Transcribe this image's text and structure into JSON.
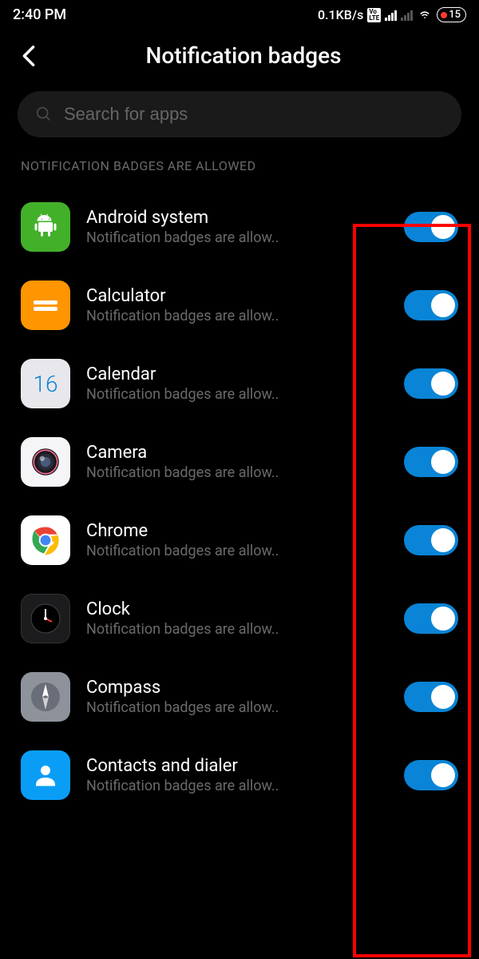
{
  "statusBar": {
    "time": "2:40 PM",
    "netSpeed": "0.1KB/s",
    "battery": "15"
  },
  "header": {
    "title": "Notification badges"
  },
  "search": {
    "placeholder": "Search for apps"
  },
  "section": {
    "label": "NOTIFICATION BADGES ARE ALLOWED"
  },
  "apps": [
    {
      "name": "Android system",
      "desc": "Notification badges are allow..",
      "icon": "android",
      "enabled": true
    },
    {
      "name": "Calculator",
      "desc": "Notification badges are allow..",
      "icon": "calculator",
      "enabled": true
    },
    {
      "name": "Calendar",
      "desc": "Notification badges are allow..",
      "icon": "calendar",
      "day": "16",
      "enabled": true
    },
    {
      "name": "Camera",
      "desc": "Notification badges are allow..",
      "icon": "camera",
      "enabled": true
    },
    {
      "name": "Chrome",
      "desc": "Notification badges are allow..",
      "icon": "chrome",
      "enabled": true
    },
    {
      "name": "Clock",
      "desc": "Notification badges are allow..",
      "icon": "clock",
      "enabled": true
    },
    {
      "name": "Compass",
      "desc": "Notification badges are allow..",
      "icon": "compass",
      "enabled": true
    },
    {
      "name": "Contacts and dialer",
      "desc": "Notification badges are allow..",
      "icon": "contacts",
      "enabled": true
    }
  ]
}
